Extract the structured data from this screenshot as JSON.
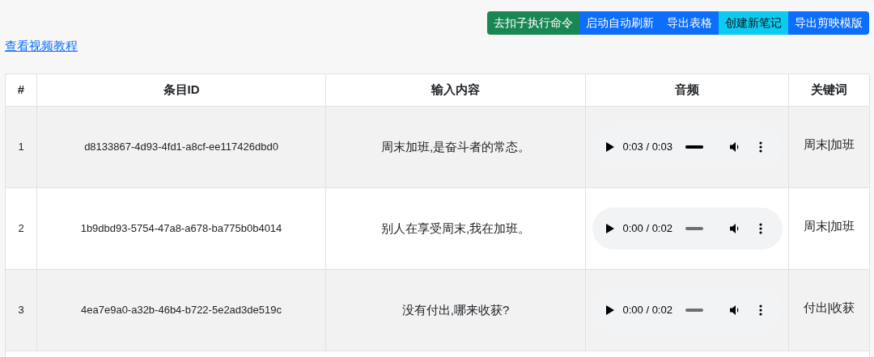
{
  "toolbar": {
    "buttons": [
      {
        "label": "去扣子执行命令",
        "kind": "success"
      },
      {
        "label": "启动自动刷新",
        "kind": "primary"
      },
      {
        "label": "导出表格",
        "kind": "primary"
      },
      {
        "label": "创建新笔记",
        "kind": "info"
      },
      {
        "label": "导出剪映模版",
        "kind": "primary"
      }
    ]
  },
  "tutorial_link": "查看视频教程",
  "table": {
    "columns": [
      "#",
      "条目ID",
      "输入内容",
      "音频",
      "关键词"
    ],
    "rows": [
      {
        "index": "1",
        "id": "d8133867-4d93-4fd1-a8cf-ee117426dbd0",
        "content": "周末加班,是奋斗者的常态。",
        "audio": {
          "time": "0:03 / 0:03",
          "level": 1
        },
        "keywords": "周末|加班"
      },
      {
        "index": "2",
        "id": "1b9dbd93-5754-47a8-a678-ba775b0b4014",
        "content": "别人在享受周末,我在加班。",
        "audio": {
          "time": "0:00 / 0:02",
          "level": 0
        },
        "keywords": "周末|加班"
      },
      {
        "index": "3",
        "id": "4ea7e9a0-a32b-46b4-b722-5e2ad3de519c",
        "content": "没有付出,哪来收获?",
        "audio": {
          "time": "0:00 / 0:02",
          "level": 0
        },
        "keywords": "付出|收获"
      }
    ]
  }
}
